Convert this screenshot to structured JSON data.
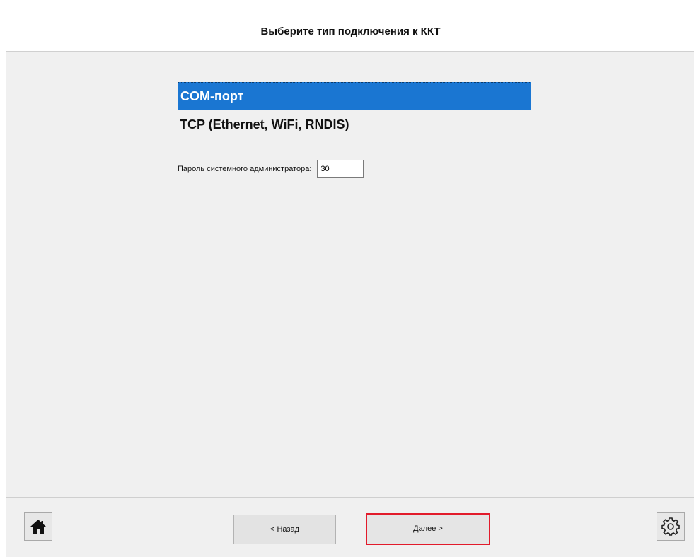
{
  "header": {
    "title": "Выберите тип подключения к ККТ"
  },
  "connection_types": [
    {
      "label": "COM-порт",
      "selected": true
    },
    {
      "label": "TCP (Ethernet, WiFi, RNDIS)",
      "selected": false
    }
  ],
  "password": {
    "label": "Пароль системного администратора:",
    "value": "30"
  },
  "footer": {
    "back_label": "< Назад",
    "next_label": "Далее >"
  },
  "icons": {
    "home": "home-icon",
    "settings": "gear-icon"
  },
  "colors": {
    "selection": "#1a76d2",
    "highlight_border": "#e21b2b"
  }
}
